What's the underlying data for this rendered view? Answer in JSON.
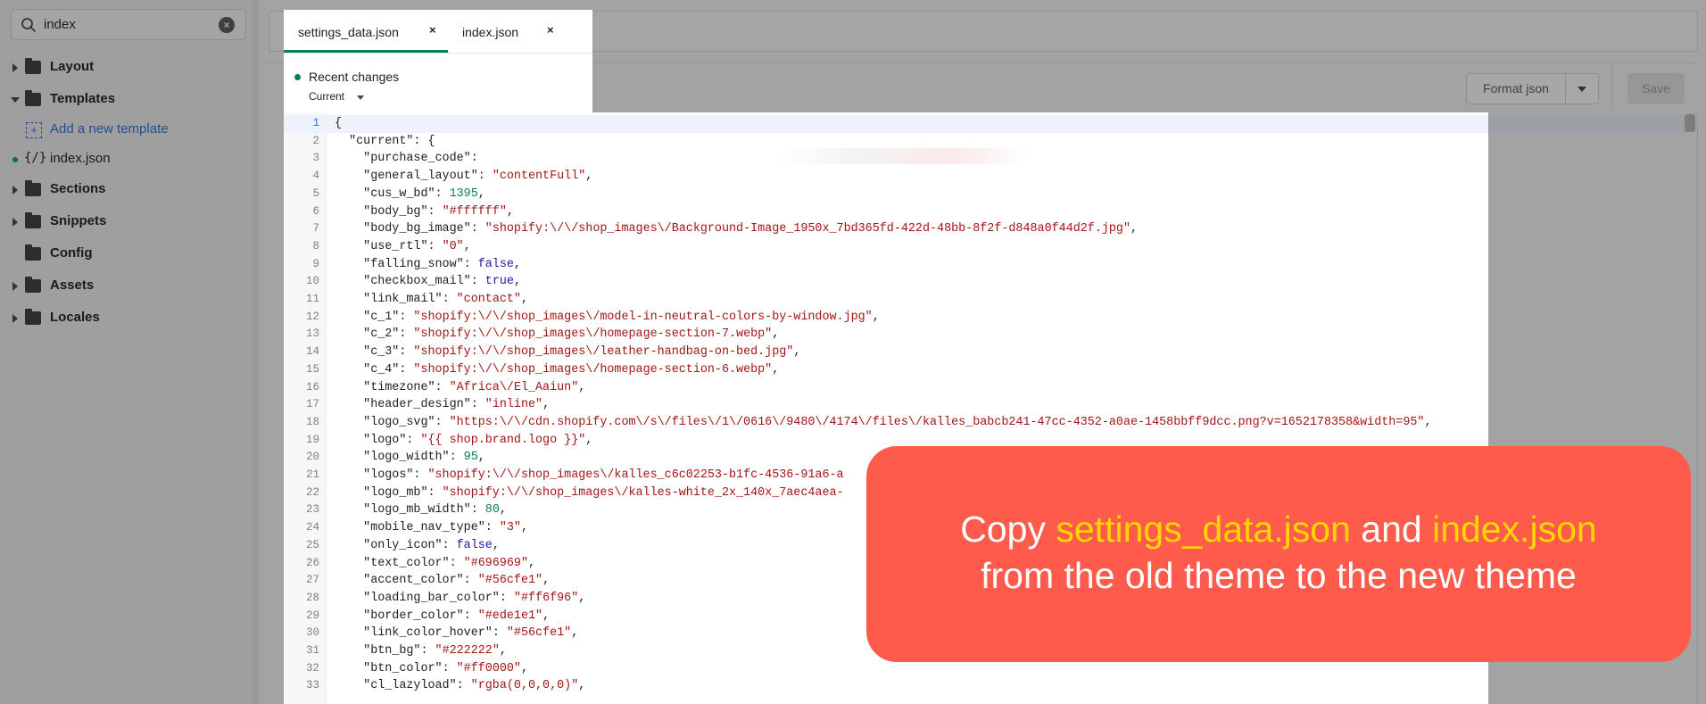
{
  "sidebar": {
    "search": {
      "value": "index"
    },
    "items": [
      {
        "label": "Layout",
        "kind": "folder",
        "expanded": false
      },
      {
        "label": "Templates",
        "kind": "folder",
        "expanded": true
      },
      {
        "label": "Add a new template",
        "kind": "add-link"
      },
      {
        "label": "index.json",
        "kind": "file",
        "modified": true
      },
      {
        "label": "Sections",
        "kind": "folder",
        "expanded": false
      },
      {
        "label": "Snippets",
        "kind": "folder",
        "expanded": false
      },
      {
        "label": "Config",
        "kind": "folder",
        "expanded": false
      },
      {
        "label": "Assets",
        "kind": "folder",
        "expanded": false
      },
      {
        "label": "Locales",
        "kind": "folder",
        "expanded": false
      }
    ]
  },
  "tabs": [
    {
      "label": "settings_data.json",
      "active": true,
      "close": "×"
    },
    {
      "label": "index.json",
      "active": false,
      "close": "×"
    }
  ],
  "recent": {
    "label": "Recent changes",
    "selected": "Current"
  },
  "toolbar": {
    "format_label": "Format json",
    "save_label": "Save"
  },
  "editor": {
    "current_line": 1,
    "lines": [
      "{",
      "  \"current\": {",
      "    \"purchase_code\": ",
      "    \"general_layout\": \"contentFull\",",
      "    \"cus_w_bd\": 1395,",
      "    \"body_bg\": \"#ffffff\",",
      "    \"body_bg_image\": \"shopify:\\/\\/shop_images\\/Background-Image_1950x_7bd365fd-422d-48bb-8f2f-d848a0f44d2f.jpg\",",
      "    \"use_rtl\": \"0\",",
      "    \"falling_snow\": false,",
      "    \"checkbox_mail\": true,",
      "    \"link_mail\": \"contact\",",
      "    \"c_1\": \"shopify:\\/\\/shop_images\\/model-in-neutral-colors-by-window.jpg\",",
      "    \"c_2\": \"shopify:\\/\\/shop_images\\/homepage-section-7.webp\",",
      "    \"c_3\": \"shopify:\\/\\/shop_images\\/leather-handbag-on-bed.jpg\",",
      "    \"c_4\": \"shopify:\\/\\/shop_images\\/homepage-section-6.webp\",",
      "    \"timezone\": \"Africa\\/El_Aaiun\",",
      "    \"header_design\": \"inline\",",
      "    \"logo_svg\": \"https:\\/\\/cdn.shopify.com\\/s\\/files\\/1\\/0616\\/9480\\/4174\\/files\\/kalles_babcb241-47cc-4352-a0ae-1458bbff9dcc.png?v=1652178358&width=95\",",
      "    \"logo\": \"{{ shop.brand.logo }}\",",
      "    \"logo_width\": 95,",
      "    \"logos\": \"shopify:\\/\\/shop_images\\/kalles_c6c02253-b1fc-4536-91a6-a",
      "    \"logo_mb\": \"shopify:\\/\\/shop_images\\/kalles-white_2x_140x_7aec4aea-",
      "    \"logo_mb_width\": 80,",
      "    \"mobile_nav_type\": \"3\",",
      "    \"only_icon\": false,",
      "    \"text_color\": \"#696969\",",
      "    \"accent_color\": \"#56cfe1\",",
      "    \"loading_bar_color\": \"#ff6f96\",",
      "    \"border_color\": \"#ede1e1\",",
      "    \"link_color_hover\": \"#56cfe1\",",
      "    \"btn_bg\": \"#222222\",",
      "    \"btn_color\": \"#ff0000\",",
      "    \"cl_lazyload\": \"rgba(0,0,0,0)\","
    ]
  },
  "callout": {
    "line1_pre": "Copy ",
    "line1_file1": "settings_data.json",
    "line1_mid": " and ",
    "line1_file2": "index.json",
    "line2": "from the old theme to the new theme"
  },
  "colors": {
    "accent_green": "#008060",
    "callout_bg": "#ff5b4c",
    "callout_highlight": "#ffd600",
    "string": "#a31515",
    "number": "#0a7d5a",
    "boolean": "#1a1aa6"
  }
}
